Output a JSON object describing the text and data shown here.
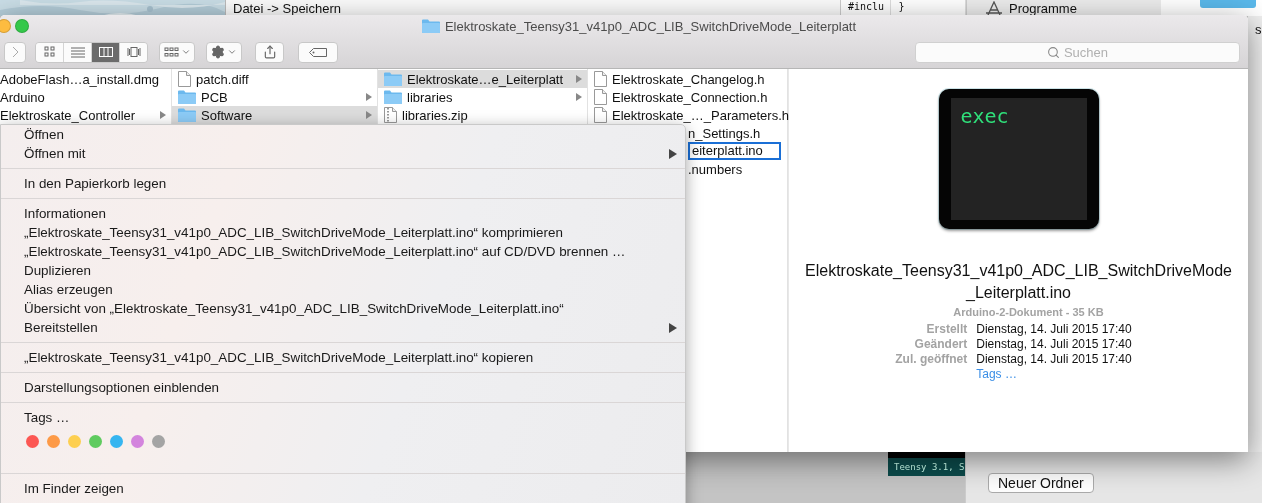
{
  "background": {
    "editor_menu_text": "Datei -> Speichern",
    "code_lines": [
      "#inclu",
      "}"
    ],
    "sidebar_item": "Programme",
    "edge_text": "s",
    "board_label": "Teensy 3.1, S",
    "dialog_button": "Neuer Ordner"
  },
  "finder": {
    "title": "Elektroskate_Teensy31_v41p0_ADC_LIB_SwitchDriveMode_Leiterplatt",
    "views": [
      {
        "kind": "icons",
        "selected": false
      },
      {
        "kind": "list",
        "selected": false
      },
      {
        "kind": "columns",
        "selected": true
      },
      {
        "kind": "coverflow",
        "selected": false
      }
    ],
    "search": {
      "placeholder": "Suchen"
    },
    "columns": [
      {
        "rows": [
          {
            "name": "AdobeFlash…a_install.dmg",
            "selected": false,
            "has_children": false
          },
          {
            "name": "Arduino",
            "selected": false,
            "has_children": false
          },
          {
            "name": "Elektroskate_Controller",
            "selected": false,
            "has_children": true
          }
        ]
      },
      {
        "rows": [
          {
            "name": "patch.diff",
            "kind": "file",
            "selected": false,
            "has_children": false
          },
          {
            "name": "PCB",
            "kind": "folder",
            "selected": false,
            "has_children": true
          },
          {
            "name": "Software",
            "kind": "folder",
            "selected": true,
            "has_children": true
          }
        ]
      },
      {
        "rows": [
          {
            "name": "Elektroskate…e_Leiterplatt",
            "kind": "folder",
            "selected": true,
            "has_children": true
          },
          {
            "name": "libraries",
            "kind": "folder",
            "selected": false,
            "has_children": true
          },
          {
            "name": "libraries.zip",
            "kind": "zip",
            "selected": false,
            "has_children": false
          }
        ]
      },
      {
        "rows": [
          {
            "name": "Elektroskate_Changelog.h",
            "kind": "file",
            "selected": false,
            "covered": false
          },
          {
            "name": "Elektroskate_Connection.h",
            "kind": "file",
            "selected": false,
            "covered": false
          },
          {
            "name": "Elektroskate_…_Parameters.h",
            "kind": "file",
            "selected": false,
            "covered": false
          },
          {
            "name": "n_Settings.h",
            "selected": false,
            "covered": true
          },
          {
            "name": "eiterplatt.ino",
            "selected": true,
            "covered": true
          },
          {
            "name": ".numbers",
            "selected": false,
            "covered": true
          }
        ]
      }
    ],
    "preview": {
      "icon_text": "exec",
      "filename": "Elektroskate_Teensy31_v41p0_ADC_LIB_SwitchDriveMode_Leiterplatt.ino",
      "kind_size": "Arduino-2-Dokument - 35 KB",
      "info": [
        {
          "label": "Erstellt",
          "value": "Dienstag, 14. Juli 2015 17:40"
        },
        {
          "label": "Geändert",
          "value": "Dienstag, 14. Juli 2015 17:40"
        },
        {
          "label": "Zul. geöffnet",
          "value": "Dienstag, 14. Juli 2015 17:40"
        }
      ],
      "tags_link": "Tags …"
    }
  },
  "context_menu": {
    "sections": [
      {
        "items": [
          {
            "kind": "item",
            "label": "Öffnen",
            "submenu": false
          },
          {
            "kind": "item",
            "label": "Öffnen mit",
            "submenu": true
          }
        ]
      },
      {
        "items": [
          {
            "kind": "item",
            "label": "In den Papierkorb legen",
            "submenu": false
          }
        ]
      },
      {
        "items": [
          {
            "kind": "item",
            "label": "Informationen",
            "submenu": false
          },
          {
            "kind": "item",
            "label": "„Elektroskate_Teensy31_v41p0_ADC_LIB_SwitchDriveMode_Leiterplatt.ino“ komprimieren",
            "submenu": false
          },
          {
            "kind": "item",
            "label": "„Elektroskate_Teensy31_v41p0_ADC_LIB_SwitchDriveMode_Leiterplatt.ino“ auf CD/DVD brennen …",
            "submenu": false
          },
          {
            "kind": "item",
            "label": "Duplizieren",
            "submenu": false
          },
          {
            "kind": "item",
            "label": "Alias erzeugen",
            "submenu": false
          },
          {
            "kind": "item",
            "label": "Übersicht von „Elektroskate_Teensy31_v41p0_ADC_LIB_SwitchDriveMode_Leiterplatt.ino“",
            "submenu": false
          },
          {
            "kind": "item",
            "label": "Bereitstellen",
            "submenu": true
          }
        ]
      },
      {
        "items": [
          {
            "kind": "item",
            "label": "„Elektroskate_Teensy31_v41p0_ADC_LIB_SwitchDriveMode_Leiterplatt.ino“ kopieren",
            "submenu": false
          }
        ]
      },
      {
        "items": [
          {
            "kind": "item",
            "label": "Darstellungsoptionen einblenden",
            "submenu": false
          }
        ]
      },
      {
        "items": [
          {
            "kind": "item",
            "label": "Tags …",
            "submenu": false
          },
          {
            "kind": "colors",
            "colors": [
              {
                "color": "#fc5753"
              },
              {
                "color": "#fd9a47"
              },
              {
                "color": "#fdcf50"
              },
              {
                "color": "#5fcb5f"
              },
              {
                "color": "#36b5f0"
              },
              {
                "color": "#d384dd"
              },
              {
                "color": "#a4a4a4"
              }
            ]
          }
        ]
      },
      {
        "items": [
          {
            "kind": "item",
            "label": "Im Finder zeigen",
            "submenu": false
          }
        ]
      }
    ]
  }
}
